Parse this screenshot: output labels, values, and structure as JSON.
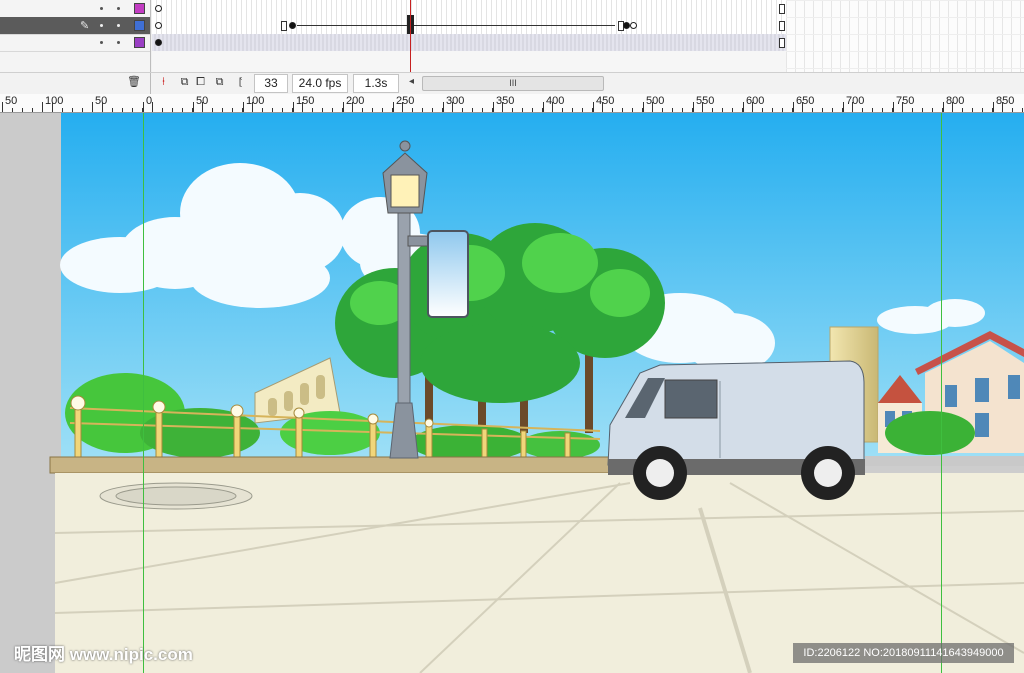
{
  "timeline": {
    "layers": [
      {
        "color": "#c23cc2",
        "active": false
      },
      {
        "color": "#3f6fd4",
        "active": true
      },
      {
        "color": "#9a3fc4",
        "active": false
      }
    ],
    "current_frame": "33",
    "fps": "24.0 fps",
    "elapsed": "1.3s",
    "scroll_grip": "III"
  },
  "ruler": {
    "labels": [
      "50",
      "100",
      "50",
      "0",
      "50",
      "100",
      "150",
      "200",
      "250",
      "300",
      "350",
      "400",
      "450",
      "500",
      "550",
      "600",
      "650",
      "700",
      "750",
      "800",
      "850"
    ]
  },
  "watermark": {
    "left": "昵图网 www.nipic.com",
    "right": "ID:2206122 NO:20180911141643949000"
  },
  "colors": {
    "sky": "#39bff0",
    "guide": "#3fbf3f",
    "pavement": "#f1eedc",
    "van": "#d3dde8"
  }
}
